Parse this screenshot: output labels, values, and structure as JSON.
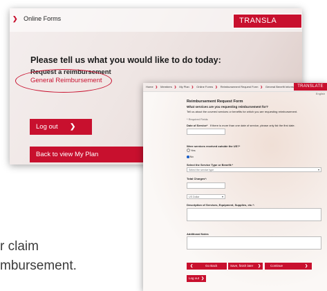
{
  "screen1": {
    "breadcrumb": "Online Forms",
    "translate": "TRANSLA",
    "question": "Please tell us what you would like to do today:",
    "request_label": "Request a reimbursement",
    "reimbursement_link": "General Reimbursement",
    "logout": "Log out",
    "back_to_plan": "Back to view My Plan"
  },
  "screen2": {
    "breadcrumbs": [
      "Home",
      "Members",
      "My Plan",
      "Online Forms",
      "Reimbursement Request Form",
      "General Benefit Information"
    ],
    "translate": "TRANSLATE",
    "language": "English",
    "form_title": "Reimbursement Request Form",
    "subtitle": "What services are you requesting reimbursement for?",
    "intro": "Tell us about the covered services or benefits for which you are requesting reimbursement.",
    "required_note": "* Required Fields",
    "date_label": "Date of Service*",
    "date_hint": "If there is more than one date of service, please only list the first date.",
    "outside_us_label": "Were services received outside the US?*",
    "option_yes": "Yes",
    "option_no": "No",
    "service_type_label": "Select the Service Type or Benefit:*",
    "service_type_placeholder": "Select the service type",
    "total_charges_label": "Total Charges*:",
    "currency_value": "US Dollar",
    "description_label": "Description of Services, Equipment, Supplies, etc.*:",
    "notes_label": "Additional Notes",
    "go_back": "Go Back",
    "save_finish_later": "Save, finish later",
    "continue": "Continue",
    "logout": "Log out"
  },
  "caption": {
    "line1": "r claim",
    "line2": "mbursement."
  },
  "colors": {
    "brand_red": "#c8102e"
  }
}
